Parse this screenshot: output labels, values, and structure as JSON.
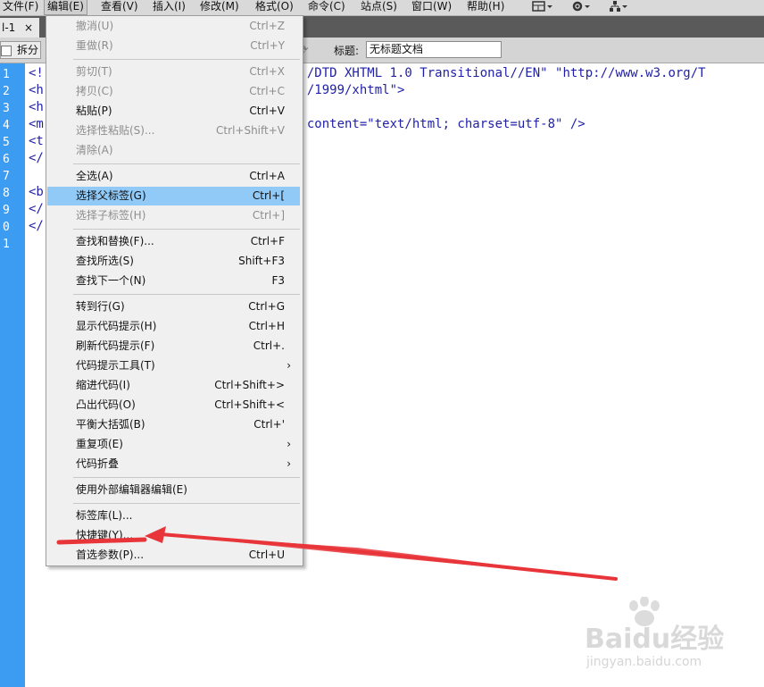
{
  "menubar": {
    "items": [
      {
        "label": "文件(F)"
      },
      {
        "label": "编辑(E)"
      },
      {
        "label": "查看(V)"
      },
      {
        "label": "插入(I)"
      },
      {
        "label": "修改(M)"
      },
      {
        "label": "格式(O)"
      },
      {
        "label": "命令(C)"
      },
      {
        "label": "站点(S)"
      },
      {
        "label": "窗口(W)"
      },
      {
        "label": "帮助(H)"
      }
    ],
    "icons": [
      "layout-icon",
      "gear-icon",
      "site-map-icon"
    ]
  },
  "tab": {
    "label": "l-1",
    "close": "×"
  },
  "toolbar": {
    "split_label": "拆分",
    "title_label": "标题:",
    "title_value": "无标题文档"
  },
  "gutter": {
    "lines": [
      "1",
      "2",
      "3",
      "4",
      "5",
      "6",
      "7",
      "8",
      "9",
      "0",
      "1"
    ]
  },
  "code": {
    "lines": [
      "<!                                   /DTD XHTML 1.0 Transitional//EN\" \"http://www.w3.org/T",
      "<h                                   /1999/xhtml\">",
      "<h",
      "<m                                 \" content=\"text/html; charset=utf-8\" />",
      "<t",
      "</",
      "",
      "<b",
      "</",
      "</"
    ]
  },
  "dropdown": {
    "items": [
      {
        "label": "撤消(U)",
        "shortcut": "Ctrl+Z",
        "disabled": true
      },
      {
        "label": "重做(R)",
        "shortcut": "Ctrl+Y",
        "disabled": true
      },
      {
        "label": "剪切(T)",
        "shortcut": "Ctrl+X",
        "disabled": true
      },
      {
        "label": "拷贝(C)",
        "shortcut": "Ctrl+C",
        "disabled": true
      },
      {
        "label": "粘贴(P)",
        "shortcut": "Ctrl+V",
        "disabled": false
      },
      {
        "label": "选择性粘贴(S)...",
        "shortcut": "Ctrl+Shift+V",
        "disabled": true
      },
      {
        "label": "清除(A)",
        "shortcut": "",
        "disabled": true
      },
      {
        "label": "全选(A)",
        "shortcut": "Ctrl+A",
        "disabled": false
      },
      {
        "label": "选择父标签(G)",
        "shortcut": "Ctrl+[",
        "disabled": false,
        "highlight": true
      },
      {
        "label": "选择子标签(H)",
        "shortcut": "Ctrl+]",
        "disabled": true
      },
      {
        "label": "查找和替换(F)...",
        "shortcut": "Ctrl+F",
        "disabled": false
      },
      {
        "label": "查找所选(S)",
        "shortcut": "Shift+F3",
        "disabled": false
      },
      {
        "label": "查找下一个(N)",
        "shortcut": "F3",
        "disabled": false
      },
      {
        "label": "转到行(G)",
        "shortcut": "Ctrl+G",
        "disabled": false
      },
      {
        "label": "显示代码提示(H)",
        "shortcut": "Ctrl+H",
        "disabled": false
      },
      {
        "label": "刷新代码提示(F)",
        "shortcut": "Ctrl+.",
        "disabled": false
      },
      {
        "label": "代码提示工具(T)",
        "shortcut": "›",
        "disabled": false
      },
      {
        "label": "缩进代码(I)",
        "shortcut": "Ctrl+Shift+>",
        "disabled": false
      },
      {
        "label": "凸出代码(O)",
        "shortcut": "Ctrl+Shift+<",
        "disabled": false
      },
      {
        "label": "平衡大括弧(B)",
        "shortcut": "Ctrl+'",
        "disabled": false
      },
      {
        "label": "重复项(E)",
        "shortcut": "›",
        "disabled": false
      },
      {
        "label": "代码折叠",
        "shortcut": "›",
        "disabled": false
      },
      {
        "label": "使用外部编辑器编辑(E)",
        "shortcut": "",
        "disabled": false
      },
      {
        "label": "标签库(L)...",
        "shortcut": "",
        "disabled": false
      },
      {
        "label": "快捷键(Y)...",
        "shortcut": "",
        "disabled": false
      },
      {
        "label": "首选参数(P)...",
        "shortcut": "Ctrl+U",
        "disabled": false
      }
    ]
  },
  "watermark": {
    "logo": "Baidu经验",
    "url": "jingyan.baidu.com"
  },
  "colors": {
    "annotation": "#e8353a",
    "highlight": "#91c9f7",
    "gutter": "#3c9cf2"
  }
}
